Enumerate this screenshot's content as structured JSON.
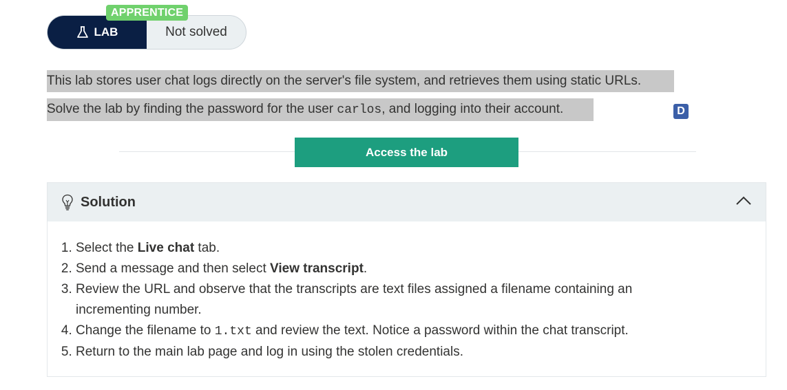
{
  "lab": {
    "level": "APPRENTICE",
    "type_label": "LAB",
    "status": "Not solved"
  },
  "description": {
    "line1": "This lab stores user chat logs directly on the server's file system, and retrieves them using static URLs.",
    "line2_before": "Solve the lab by finding the password for the user ",
    "line2_code": "carlos",
    "line2_after": ", and logging into their account."
  },
  "badge": {
    "letter": "D",
    "color": "#3b5fa8"
  },
  "access_button": {
    "label": "Access the lab",
    "color": "#1d9e7f"
  },
  "solution": {
    "title": "Solution",
    "steps": [
      {
        "before": "Select the ",
        "bold": "Live chat",
        "after": " tab."
      },
      {
        "before": "Send a message and then select ",
        "bold": "View transcript",
        "after": "."
      },
      {
        "text": "Review the URL and observe that the transcripts are text files assigned a filename containing an incrementing number."
      },
      {
        "before": "Change the filename to ",
        "code": "1.txt",
        "after": " and review the text. Notice a password within the chat transcript."
      },
      {
        "text": "Return to the main lab page and log in using the stolen credentials."
      }
    ]
  },
  "icons": {
    "lab_type": "flask-icon",
    "solution": "lightbulb-icon",
    "collapse": "chevron-up-icon"
  }
}
